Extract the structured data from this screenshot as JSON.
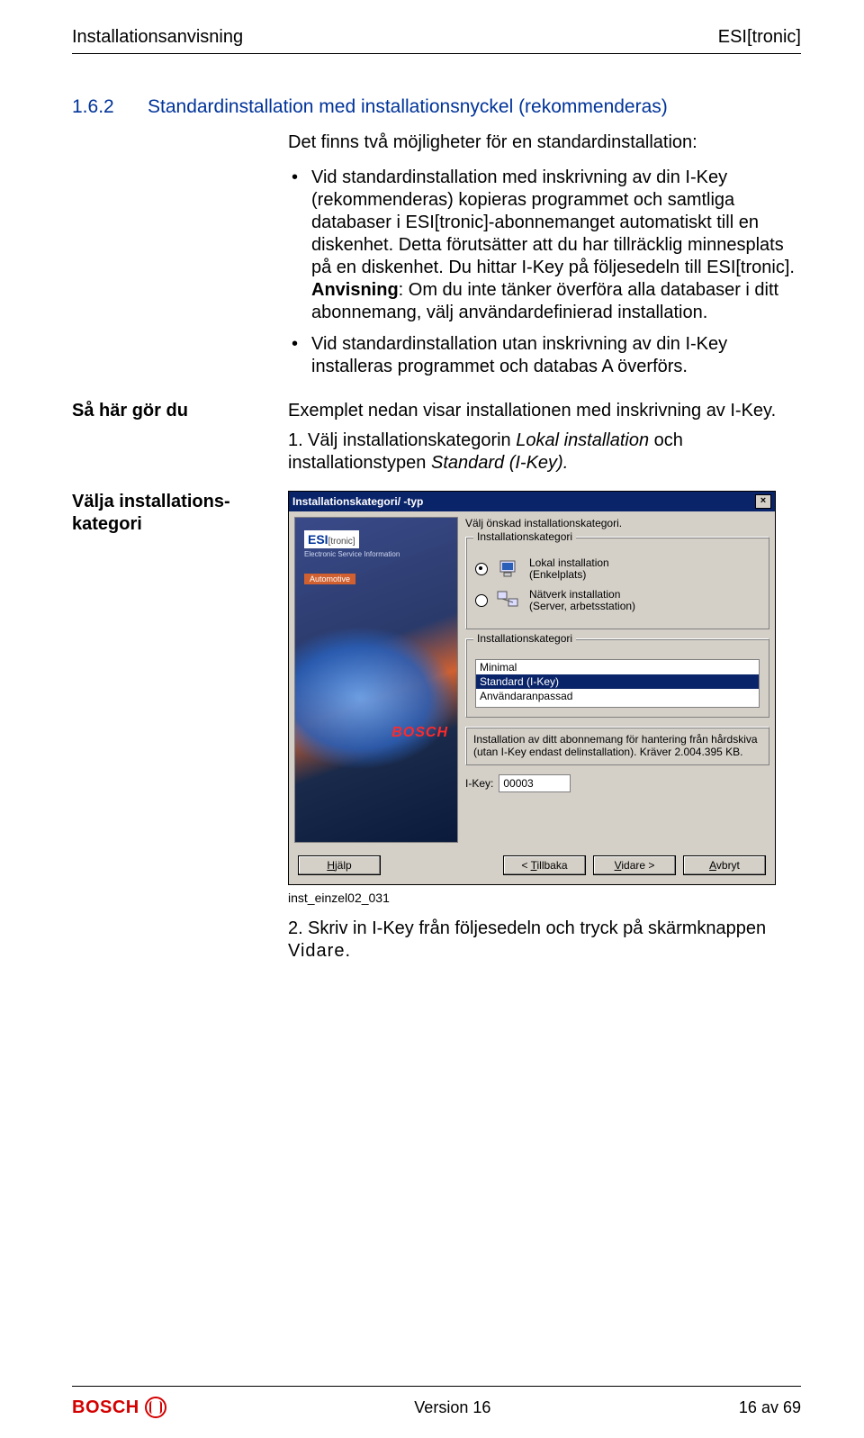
{
  "header": {
    "left": "Installationsanvisning",
    "right": "ESI[tronic]"
  },
  "section": {
    "num": "1.6.2",
    "title": "Standardinstallation med installationsnyckel (rekommenderas)"
  },
  "intro": "Det finns två möjligheter för en standardinstallation:",
  "bullet1_main": "Vid standardinstallation med inskrivning av din I-Key (rekommenderas) kopieras programmet och samtliga databaser i ESI[tronic]-abonnemanget automatiskt till en diskenhet. Detta förutsätter att du har tillräcklig minnesplats på en diskenhet. Du hittar I-Key på följesedeln till ESI[tronic].",
  "bullet1_note_label": "Anvisning",
  "bullet1_note_rest": ": Om du inte tänker överföra alla databaser i ditt abonnemang, välj användardefinierad installation.",
  "bullet2": "Vid standardinstallation utan inskrivning av din I-Key installeras programmet och databas A överförs.",
  "example_line": "Exemplet nedan visar installationen med inskrivning av I-Key.",
  "left_label_1": "Så här gör du",
  "step1_num": "1.",
  "step1_a": "Välj installationskategorin ",
  "step1_it1": "Lokal installation",
  "step1_mid": " och installationstypen ",
  "step1_it2": "Standard (I-Key).",
  "left_label_2": "Välja installations-kategori",
  "screenshot": {
    "title": "Installationskategori/ -typ",
    "prompt": "Välj önskad installationskategori.",
    "group1_legend": "Installationskategori",
    "radio1_line1": "Lokal installation",
    "radio1_line2": "(Enkelplats)",
    "radio2_line1": "Nätverk installation",
    "radio2_line2": "(Server, arbetsstation)",
    "group2_legend": "Installationskategori",
    "list_items": [
      "Minimal",
      "Standard (I-Key)",
      "Användaranpassad"
    ],
    "list_selected_index": 1,
    "desc": "Installation av ditt abonnemang för hantering från hårdskiva (utan I-Key endast delinstallation). Kräver 2.004.395 KB.",
    "ikey_label": "I-Key:",
    "ikey_value": "00003",
    "btn_help": "Hjälp",
    "btn_back": "< Tillbaka",
    "btn_next": "Vidare >",
    "btn_cancel": "Avbryt",
    "sidebar_brand": "ESI",
    "sidebar_brand_sub": "[tronic]",
    "sidebar_tag": "Electronic Service Information",
    "sidebar_auto": "Automotive",
    "sidebar_bosch": "BOSCH"
  },
  "caption": "inst_einzel02_031",
  "step2_num": "2.",
  "step2_a": "Skriv in I-Key från följesedeln och tryck på skärmknappen ",
  "step2_b": "Vidare",
  "step2_c": ".",
  "footer": {
    "brand": "BOSCH",
    "version": "Version 16",
    "page": "16 av 69"
  }
}
